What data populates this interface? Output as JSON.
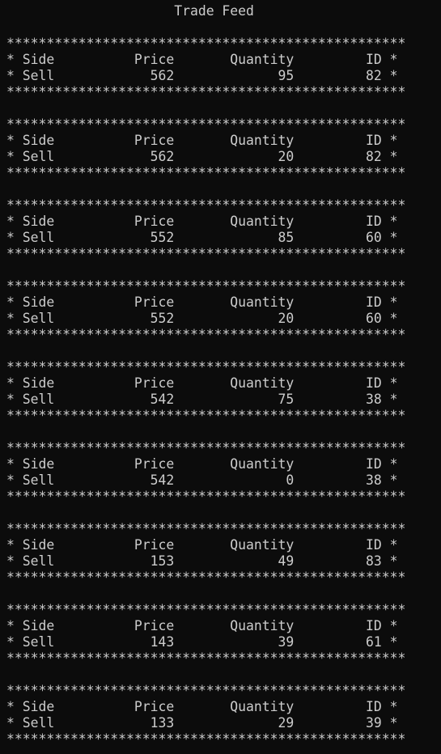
{
  "title": "Trade Feed",
  "border": "**************************************************",
  "headers": {
    "side": "Side",
    "price": "Price",
    "quantity": "Quantity",
    "id": "ID"
  },
  "trades": [
    {
      "side": "Sell",
      "price": "562",
      "quantity": "95",
      "id": "82"
    },
    {
      "side": "Sell",
      "price": "562",
      "quantity": "20",
      "id": "82"
    },
    {
      "side": "Sell",
      "price": "552",
      "quantity": "85",
      "id": "60"
    },
    {
      "side": "Sell",
      "price": "552",
      "quantity": "20",
      "id": "60"
    },
    {
      "side": "Sell",
      "price": "542",
      "quantity": "75",
      "id": "38"
    },
    {
      "side": "Sell",
      "price": "542",
      "quantity": "0",
      "id": "38"
    },
    {
      "side": "Sell",
      "price": "153",
      "quantity": "49",
      "id": "83"
    },
    {
      "side": "Sell",
      "price": "143",
      "quantity": "39",
      "id": "61"
    },
    {
      "side": "Sell",
      "price": "133",
      "quantity": "29",
      "id": "39"
    }
  ]
}
